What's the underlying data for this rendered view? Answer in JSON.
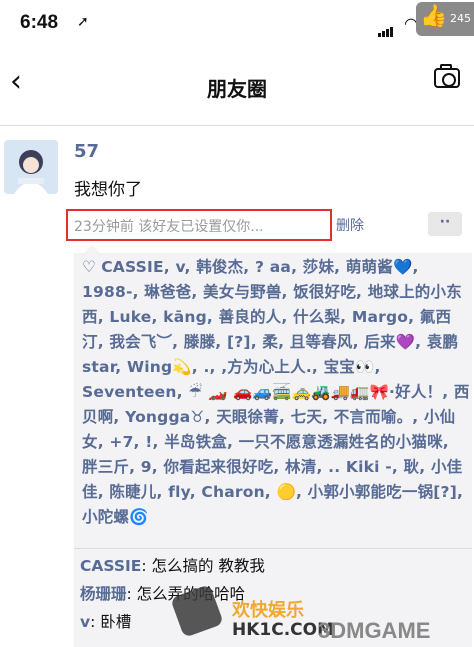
{
  "status_bar": {
    "time": "6:48",
    "thumb_count": "245"
  },
  "nav": {
    "title": "朋友圈"
  },
  "post": {
    "username": "57",
    "content": "我想你了",
    "meta": "23分钟前  该好友已设置仅你...",
    "delete_label": "删除",
    "more_label": "··"
  },
  "likes": {
    "text": "CASSIE, v, 韩俊杰, ? aa, 莎妹, 萌萌酱💙, 1988-, 琳爸爸, 美女与野兽, 饭很好吃, 地球上的小东西, Luke, kāng, 善良的人, 什么梨, Margo, 氟西汀, 我会飞︶, 滕滕, [?], 柔, 且等春风, 后来💜, 袁鹏star, Wing💫, ., ,方为心上人., 宝宝👀, Seventeen, ☔ 🏎️ 🚗🚙🚎🚕🚜🚚🚛🎀·好人！, 西贝啊, Yongga♉, 天眼徐菁, 七天, 不言而喻。, 小仙女, +7, !, 半岛铁盒, 一只不愿意透漏姓名的小猫咪, 胖三斤, 9, 你看起来很好吃, 林清, .. Kiki -, 耿, 小佳佳, 陈睫儿, fly, Charon, 🟡, 小郭小郭能吃一锅[?], 小陀螺🌀"
  },
  "comments": [
    {
      "user": "CASSIE",
      "text": ": 怎么搞的 教教我"
    },
    {
      "user": "杨珊珊",
      "text": ": 怎么弄的哈哈哈"
    },
    {
      "user": "v",
      "text": ": 卧槽"
    }
  ],
  "watermark": {
    "line1": "欢快娱乐",
    "line2": "HK1C.COM",
    "line3": "3DMGAME"
  }
}
